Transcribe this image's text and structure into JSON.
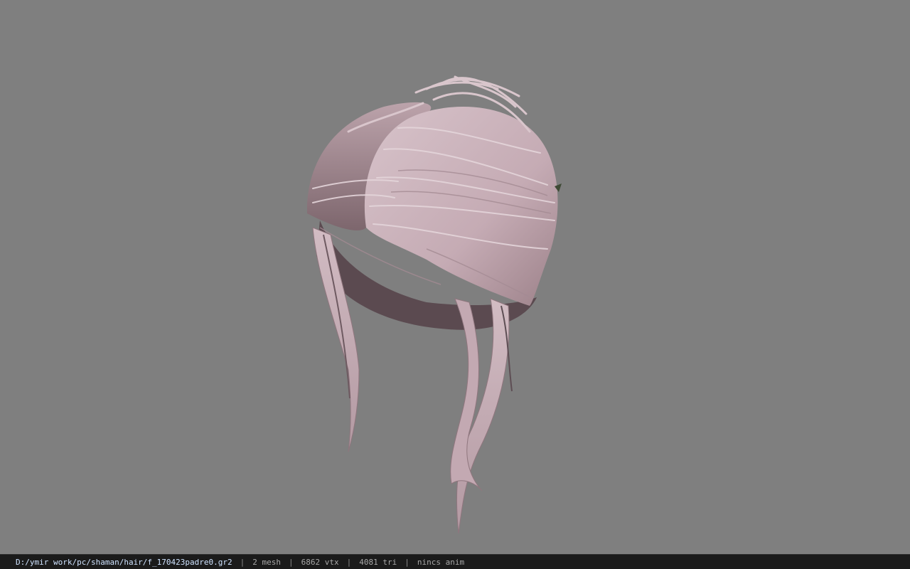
{
  "viewport": {
    "background_color": "#7f7f7f",
    "model": {
      "icon": "hair-mesh-model",
      "hair_color": "#c9b1b9",
      "shadow_color": "#5e4e54"
    }
  },
  "statusbar": {
    "file_path": "D:/ymir work/pc/shaman/hair/f_170423padre0.gr2",
    "separator": "|",
    "mesh_count": "2 mesh",
    "vertex_count": "6862 vtx",
    "triangle_count": "4081 tri",
    "anim_status": "nincs anim"
  }
}
